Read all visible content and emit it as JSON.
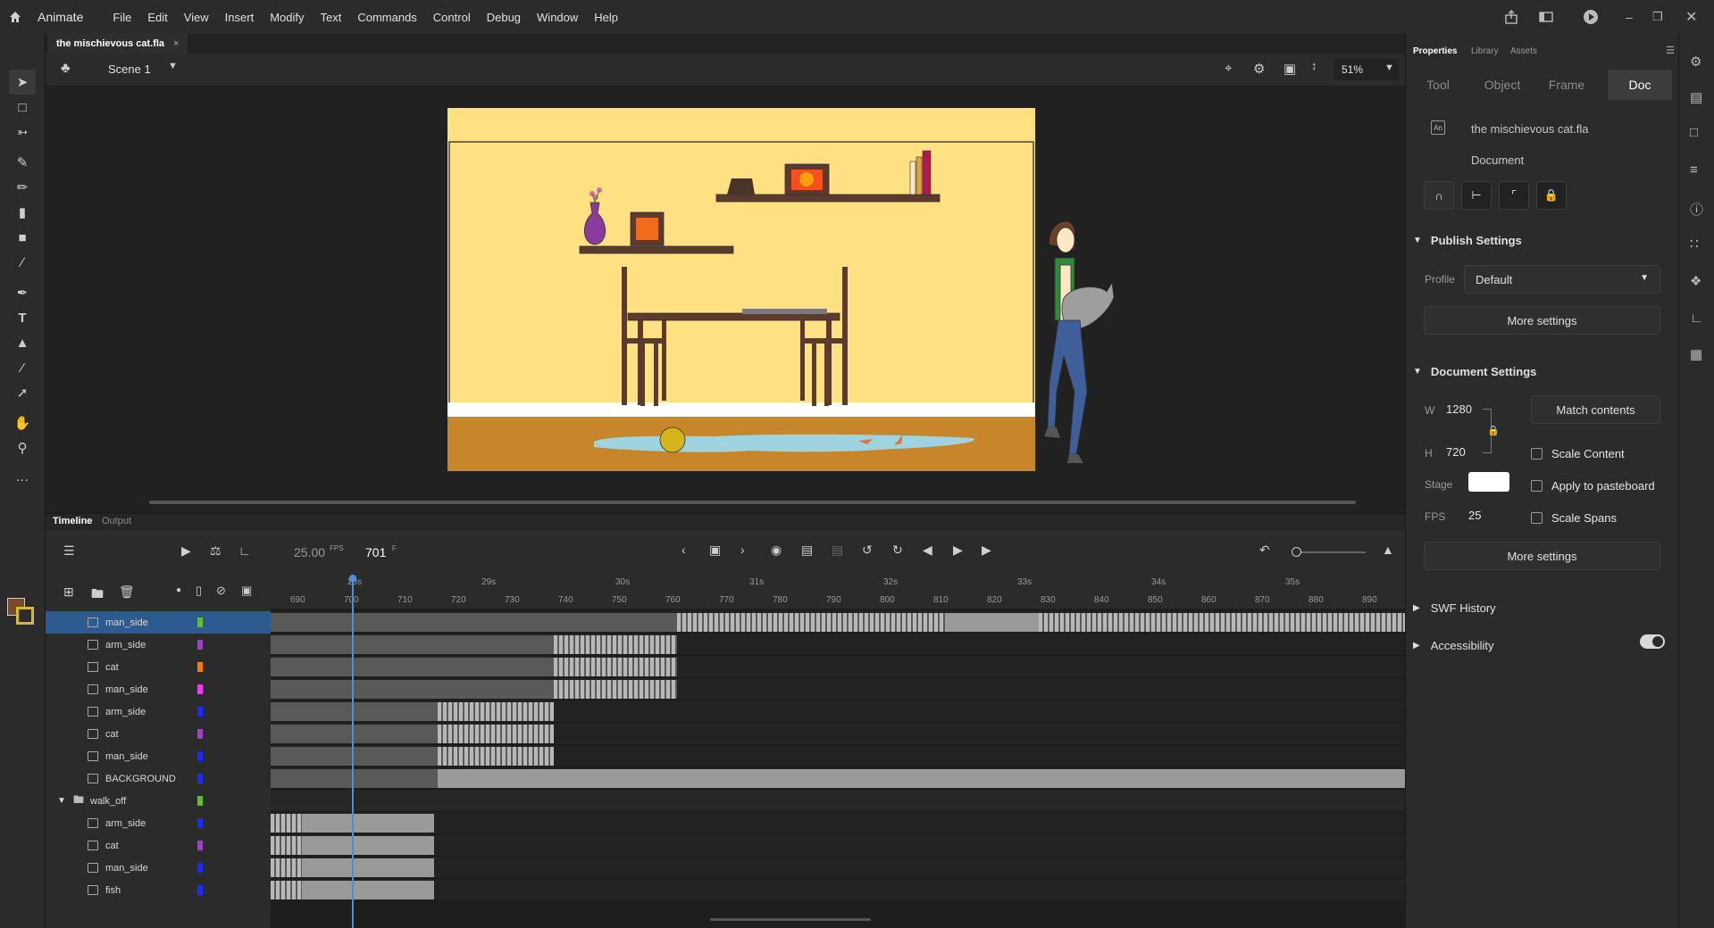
{
  "app": {
    "name": "Animate"
  },
  "menu": [
    "File",
    "Edit",
    "View",
    "Insert",
    "Modify",
    "Text",
    "Commands",
    "Control",
    "Debug",
    "Window",
    "Help"
  ],
  "document": {
    "tab_title": "the mischievous cat.fla"
  },
  "scene": {
    "name": "Scene 1",
    "zoom": "51%"
  },
  "timeline": {
    "panel_tabs": [
      "Timeline",
      "Output"
    ],
    "fps": "25.00",
    "fps_unit": "FPS",
    "current_frame": "701",
    "frame_unit": "F",
    "ruler_frames": [
      "690",
      "700",
      "710",
      "720",
      "730",
      "740",
      "750",
      "760",
      "770",
      "780",
      "790",
      "800",
      "810",
      "820",
      "830",
      "840",
      "850",
      "860",
      "870",
      "880",
      "890"
    ],
    "ruler_seconds": [
      "28s",
      "29s",
      "30s",
      "31s",
      "32s",
      "33s",
      "34s",
      "35s"
    ],
    "layers": [
      {
        "name": "man_side",
        "color": "#5fbf2a"
      },
      {
        "name": "arm_side",
        "color": "#a040c8"
      },
      {
        "name": "cat",
        "color": "#ff7a00"
      },
      {
        "name": "man_side",
        "color": "#ff30ff"
      },
      {
        "name": "arm_side",
        "color": "#1a2aff"
      },
      {
        "name": "cat",
        "color": "#a040c8"
      },
      {
        "name": "man_side",
        "color": "#1a2aff"
      },
      {
        "name": "BACKGROUND",
        "color": "#1a2aff"
      },
      {
        "name": "walk_off",
        "color": "#5fbf2a"
      },
      {
        "name": "arm_side",
        "color": "#1a2aff"
      },
      {
        "name": "cat",
        "color": "#a040c8"
      },
      {
        "name": "man_side",
        "color": "#1a2aff"
      },
      {
        "name": "fish",
        "color": "#1a2aff"
      }
    ]
  },
  "properties": {
    "tabs": [
      "Properties",
      "Library",
      "Assets"
    ],
    "subtabs": [
      "Tool",
      "Object",
      "Frame",
      "Doc"
    ],
    "doc_name": "the mischievous cat.fla",
    "doc_type": "Document",
    "publish_settings": {
      "title": "Publish Settings",
      "profile_label": "Profile",
      "profile_value": "Default",
      "more": "More settings"
    },
    "document_settings": {
      "title": "Document Settings",
      "w_label": "W",
      "w_value": "1280",
      "h_label": "H",
      "h_value": "720",
      "match": "Match contents",
      "scale_content": "Scale Content",
      "stage_label": "Stage",
      "apply_pasteboard": "Apply to pasteboard",
      "fps_label": "FPS",
      "fps_value": "25",
      "scale_spans": "Scale Spans",
      "more": "More settings"
    },
    "swf_history": "SWF History",
    "accessibility": "Accessibility"
  },
  "colors": {
    "accent": "#2d5b8f",
    "playhead": "#4a90e2",
    "stage_wall": "#ffe082",
    "stage_floor": "#c8862b"
  }
}
